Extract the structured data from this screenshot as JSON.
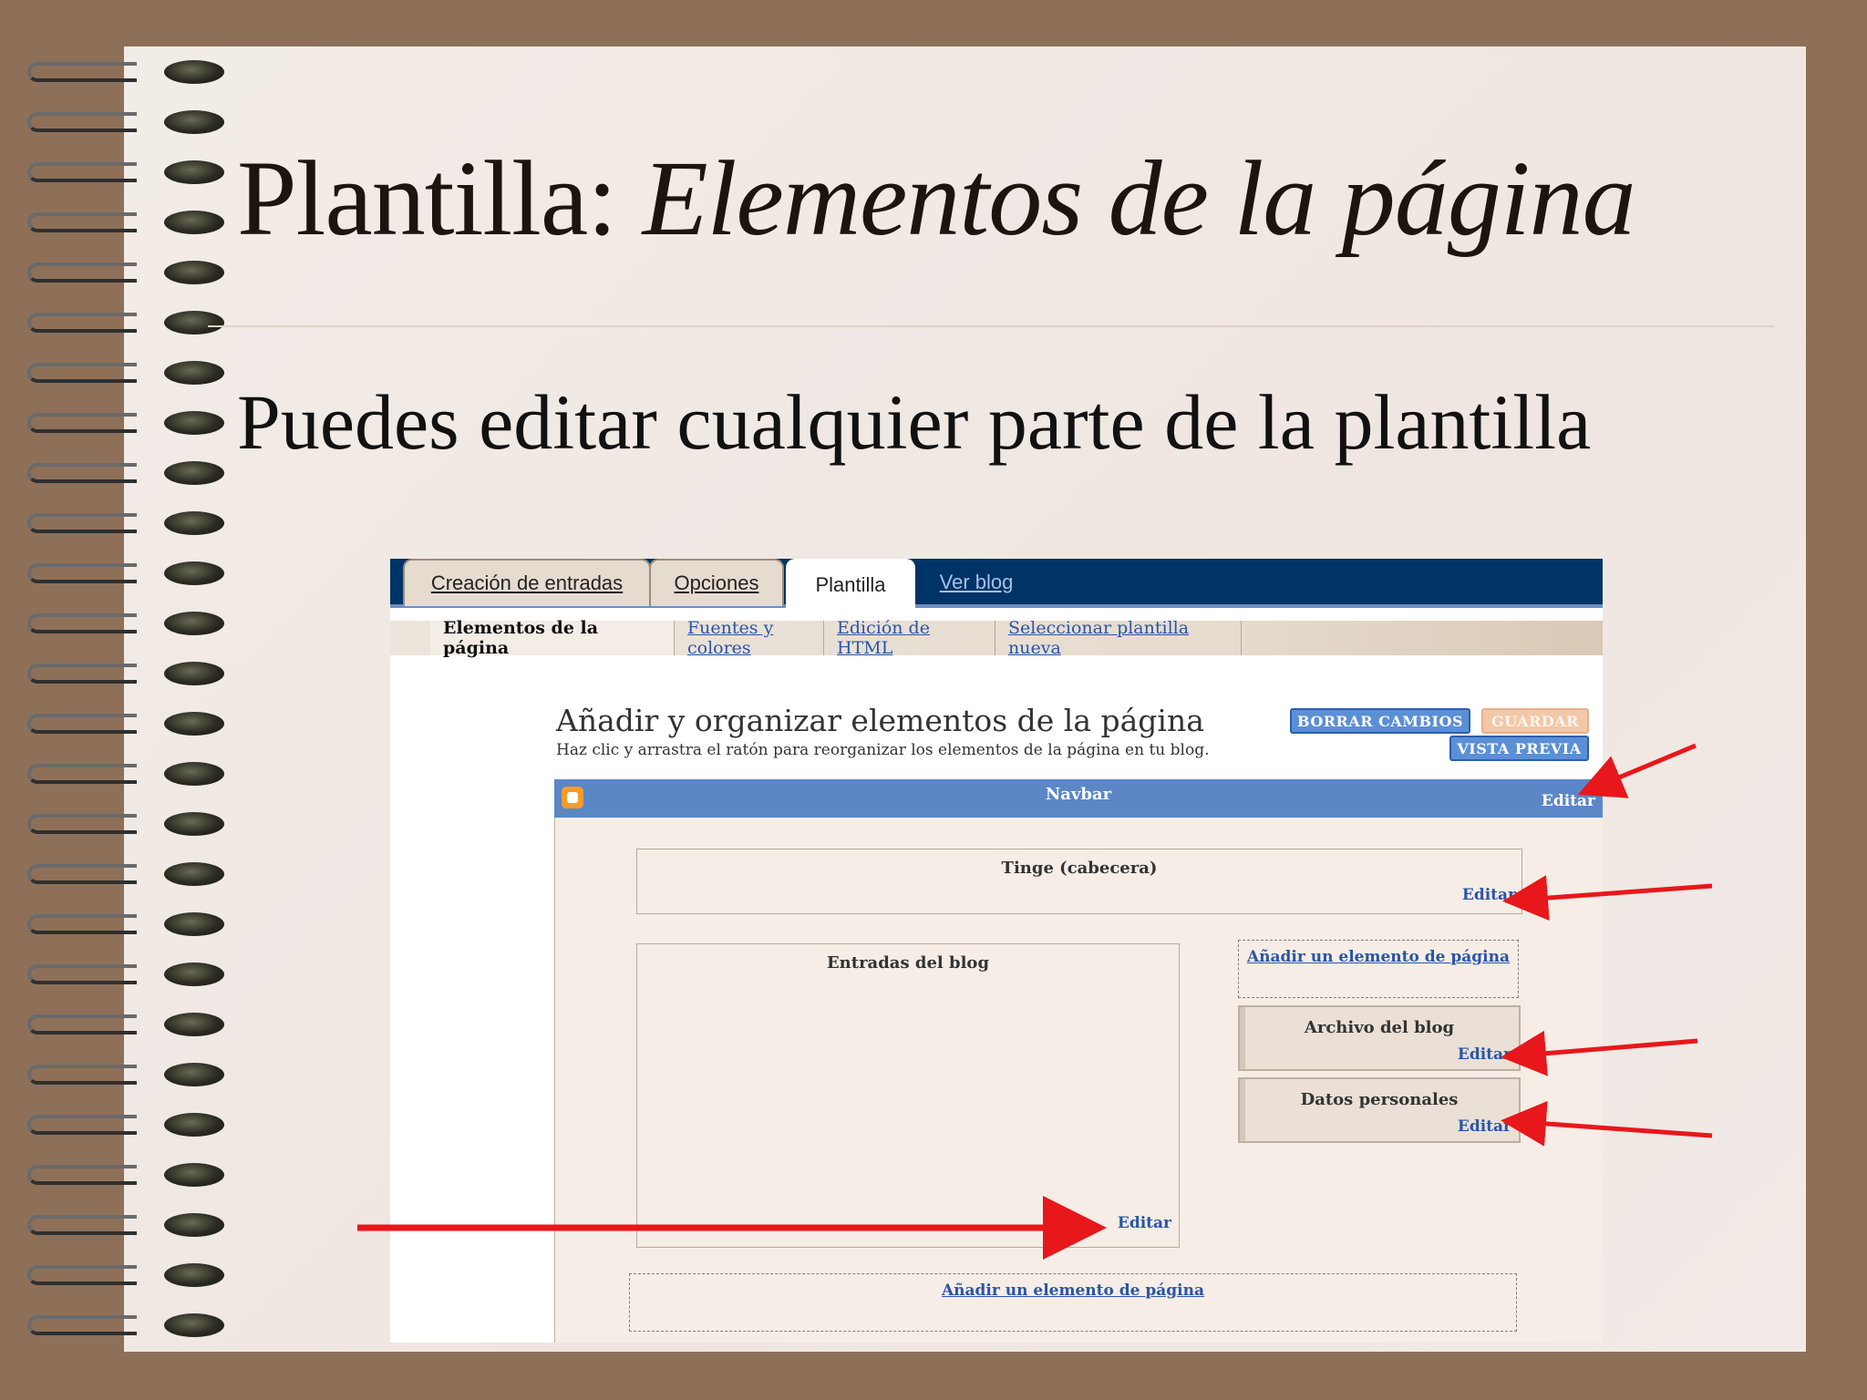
{
  "slide": {
    "title_plain": "Plantilla: ",
    "title_italic": "Elementos de la página",
    "bullet": "Puedes editar cualquier parte de la plantilla"
  },
  "screenshot": {
    "tabs": [
      "Creación de entradas",
      "Opciones",
      "Plantilla",
      "Ver blog"
    ],
    "subtabs": [
      "Elementos de la página",
      "Fuentes y colores",
      "Edición de HTML",
      "Seleccionar plantilla nueva"
    ],
    "heading": "Añadir y organizar elementos de la página",
    "subheading": "Haz clic y arrastra el ratón para reorganizar los elementos de la página en tu blog.",
    "buttons": {
      "clear": "BORRAR CAMBIOS",
      "save": "GUARDAR",
      "preview": "VISTA PREVIA"
    },
    "navbar": {
      "title": "Navbar",
      "edit": "Editar"
    },
    "header_box": {
      "title": "Tinge (cabecera)",
      "edit": "Editar"
    },
    "posts_box": {
      "title": "Entradas del blog",
      "edit": "Editar"
    },
    "sidebar": {
      "add_link": "Añadir un elemento de página",
      "archive": {
        "title": "Archivo del blog",
        "edit": "Editar"
      },
      "profile": {
        "title": "Datos personales",
        "edit": "Editar"
      }
    },
    "footer_add_link": "Añadir un elemento de página"
  },
  "colors": {
    "accent_arrow": "#e8171b",
    "tabbar": "#003366",
    "navbar": "#5b87c7",
    "link": "#2a55a8"
  }
}
